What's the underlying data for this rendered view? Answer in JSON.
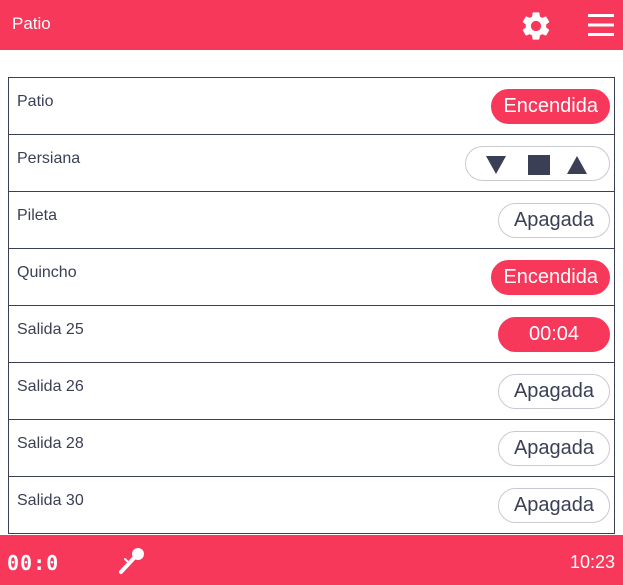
{
  "header": {
    "title": "Patio"
  },
  "rows": [
    {
      "name": "Patio",
      "state": "Encendida",
      "on": true
    },
    {
      "name": "Persiana",
      "type": "blind",
      "controls": [
        "down-triangle-icon",
        "stop-square-icon",
        "up-triangle-icon"
      ]
    },
    {
      "name": "Pileta",
      "state": "Apagada",
      "on": false
    },
    {
      "name": "Quincho",
      "state": "Encendida",
      "on": true
    },
    {
      "name": "Salida 25",
      "state": "00:04",
      "on": true
    },
    {
      "name": "Salida 26",
      "state": "Apagada",
      "on": false
    },
    {
      "name": "Salida 28",
      "state": "Apagada",
      "on": false
    },
    {
      "name": "Salida 30",
      "state": "Apagada",
      "on": false
    }
  ],
  "footer": {
    "timer": "00:0",
    "clock": "10:23"
  },
  "colors": {
    "accent": "#f7385a",
    "text": "#3a3f55",
    "border": "#c9c9d2"
  }
}
